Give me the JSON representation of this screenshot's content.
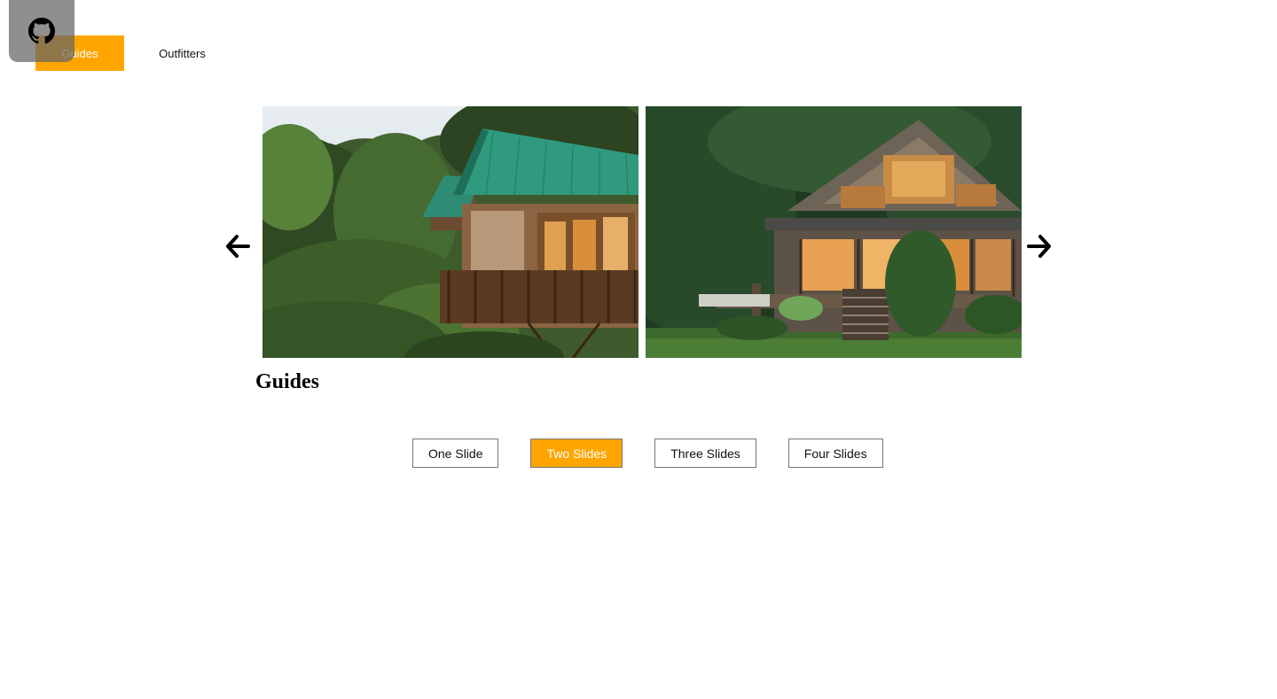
{
  "nav": {
    "tabs": [
      {
        "label": "Guides",
        "active": true
      },
      {
        "label": "Outfitters",
        "active": false
      }
    ]
  },
  "github": {
    "icon": "github-icon"
  },
  "carousel": {
    "prev_icon": "arrow-left-icon",
    "next_icon": "arrow-right-icon",
    "slides": [
      {
        "image": "treehouse-lodge-with-green-roofs-in-jungle"
      },
      {
        "image": "wooden-lodge-with-lit-porch-in-forest"
      }
    ],
    "heading": "Guides"
  },
  "modes": [
    {
      "label": "One Slide",
      "active": false
    },
    {
      "label": "Two Slides",
      "active": true
    },
    {
      "label": "Three Slides",
      "active": false
    },
    {
      "label": "Four Slides",
      "active": false
    }
  ],
  "colors": {
    "accent": "#ffa500",
    "github_overlay": "#646464"
  }
}
